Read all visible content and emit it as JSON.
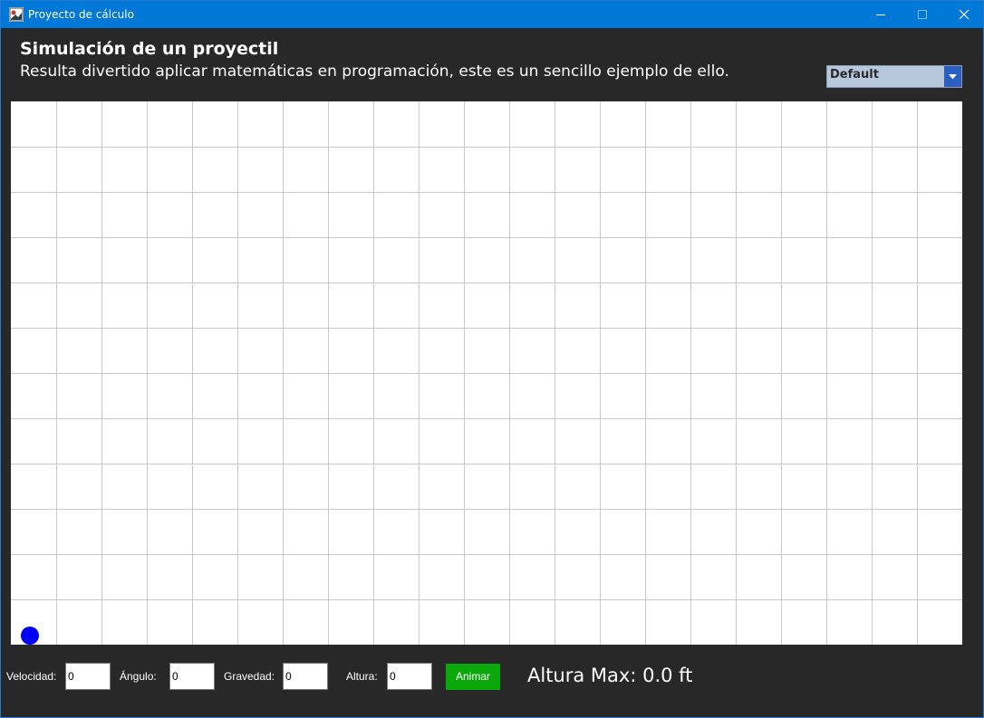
{
  "window": {
    "title": "Proyecto de cálculo",
    "accent_color": "#0078d7",
    "controls": [
      "minimize-icon",
      "maximize-icon",
      "close-icon"
    ]
  },
  "header": {
    "title": "Simulación de un proyectil",
    "subtitle": "Resulta divertido aplicar matemáticas en programación, este es un sencillo ejemplo de ello."
  },
  "theme_select": {
    "selected": "Default",
    "icon": "chevron-down-icon"
  },
  "canvas": {
    "background": "#ffffff",
    "grid_color": "#c8c8c8",
    "grid_on": true,
    "projectile_color": "#0000ff"
  },
  "controls": {
    "velocity": {
      "label": "Velocidad:",
      "value": "0"
    },
    "angle": {
      "label": "Ángulo:",
      "value": "0"
    },
    "gravity": {
      "label": "Gravedad:",
      "value": "0"
    },
    "height": {
      "label": "Altura:",
      "value": "0"
    },
    "animate_label": "Animar",
    "animate_color": "#0aa80a",
    "max_height": "Altura Max: 0.0 ft"
  }
}
